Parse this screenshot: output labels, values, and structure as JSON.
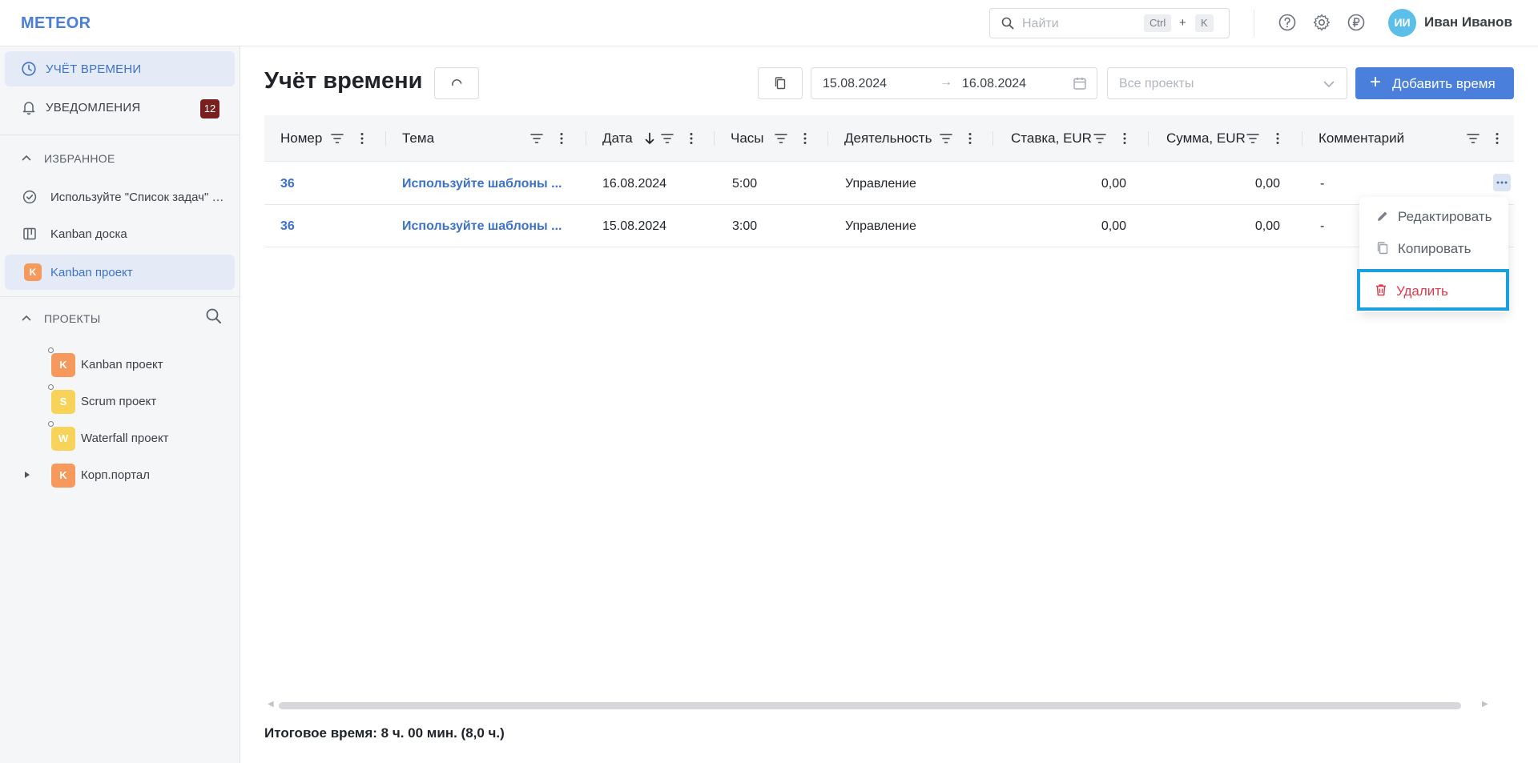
{
  "app": {
    "logo": "METEOR"
  },
  "search": {
    "placeholder": "Найти",
    "kbd_ctrl": "Ctrl",
    "kbd_plus": "+",
    "kbd_k": "K"
  },
  "user": {
    "initials": "ИИ",
    "name": "Иван Иванов",
    "avatar_color": "#5bbfe8"
  },
  "sidebar": {
    "nav": [
      {
        "label": "УЧЁТ ВРЕМЕНИ",
        "icon": "clock-icon",
        "active": true
      },
      {
        "label": "УВЕДОМЛЕНИЯ",
        "icon": "bell-icon",
        "badge": "12"
      }
    ],
    "favorites_title": "ИЗБРАННОЕ",
    "favorites": [
      {
        "label": "Используйте \"Список задач\" для планирования работ",
        "icon": "check-circle-icon"
      },
      {
        "label": "Kanban доска",
        "icon": "kanban-board-icon"
      },
      {
        "label": "Kanban проект",
        "badge": "K",
        "badge_color": "#f59a5c",
        "active": true
      }
    ],
    "projects_title": "ПРОЕКТЫ",
    "projects": [
      {
        "label": "Kanban проект",
        "badge": "K",
        "badge_color": "#f59a5c"
      },
      {
        "label": "Scrum проект",
        "badge": "S",
        "badge_color": "#f7d35a"
      },
      {
        "label": "Waterfall проект",
        "badge": "W",
        "badge_color": "#f7d35a"
      },
      {
        "label": "Корп.портал",
        "badge": "K",
        "badge_color": "#f59a5c"
      }
    ]
  },
  "main": {
    "title": "Учёт времени",
    "date_from": "15.08.2024",
    "date_arrow": "→",
    "date_to": "16.08.2024",
    "project_placeholder": "Все проекты",
    "add_button": "Добавить время",
    "add_plus": "+",
    "primary_color": "#4a80db"
  },
  "table": {
    "columns": [
      "Номер",
      "Тема",
      "Дата",
      "Часы",
      "Деятельность",
      "Ставка, EUR",
      "Сумма, EUR",
      "Комментарий"
    ],
    "rows": [
      [
        "36",
        "Используйте шаблоны ...",
        "16.08.2024",
        "5:00",
        "Управление",
        "0,00",
        "0,00",
        "-"
      ],
      [
        "36",
        "Используйте шаблоны ...",
        "15.08.2024",
        "3:00",
        "Управление",
        "0,00",
        "0,00",
        "-"
      ]
    ]
  },
  "context_menu": {
    "items": [
      {
        "label": "Редактировать",
        "icon": "pencil-icon"
      },
      {
        "label": "Копировать",
        "icon": "copy-icon"
      },
      {
        "label": "Удалить",
        "icon": "trash-icon",
        "danger": true,
        "danger_color": "#e0394a"
      }
    ]
  },
  "footer": {
    "total": "Итоговое время: 8 ч. 00 мин. (8,0 ч.)"
  }
}
